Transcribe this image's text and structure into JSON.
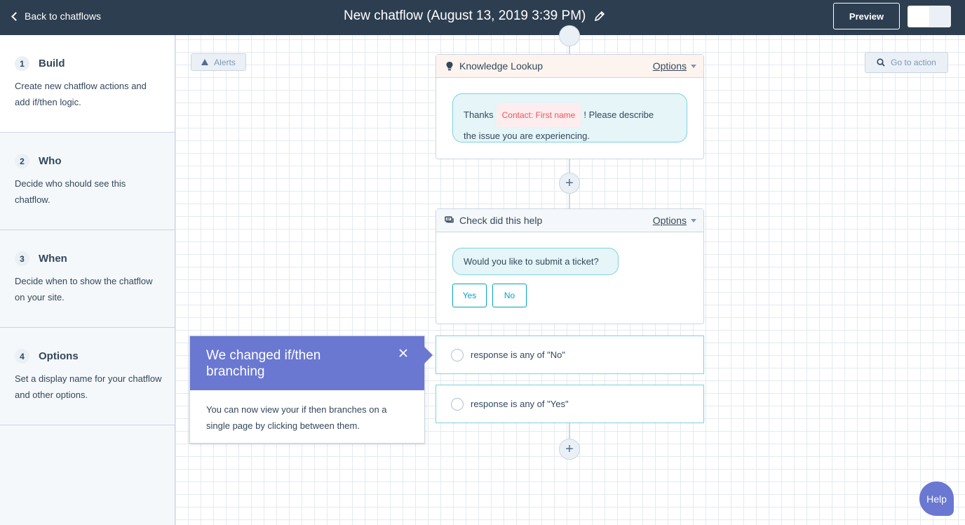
{
  "header": {
    "back_label": "Back to chatflows",
    "title": "New chatflow (August 13, 2019 3:39 PM)",
    "preview_label": "Preview"
  },
  "sidebar": {
    "steps": [
      {
        "number": "1",
        "title": "Build",
        "description": "Create new chatflow actions and add if/then logic."
      },
      {
        "number": "2",
        "title": "Who",
        "description": "Decide who should see this chatflow."
      },
      {
        "number": "3",
        "title": "When",
        "description": "Decide when to show the chatflow on your site."
      },
      {
        "number": "4",
        "title": "Options",
        "description": "Set a display name for your chatflow and other options."
      }
    ]
  },
  "toolbar": {
    "alerts_label": "Alerts",
    "goto_label": "Go to action"
  },
  "cards": {
    "knowledge": {
      "title": "Knowledge Lookup",
      "options_label": "Options",
      "message_prefix": "Thanks",
      "token_label": "Contact: First name",
      "message_suffix": "! Please describe",
      "message_line2": "the issue you are experiencing."
    },
    "check": {
      "title": "Check did this help",
      "options_label": "Options",
      "message": "Would you like to submit a ticket?",
      "buttons": [
        "Yes",
        "No"
      ]
    }
  },
  "branches": [
    {
      "label": "response is any of \"No\""
    },
    {
      "label": "response is any of \"Yes\""
    }
  ],
  "popover": {
    "title": "We changed if/then branching",
    "body": "You can now view your if then branches on a single page by clicking between them."
  },
  "help_label": "Help",
  "colors": {
    "header_bg": "#2d3e50",
    "accent": "#6a78d1",
    "teal": "#00a4bd",
    "token_red": "#f2545b"
  }
}
